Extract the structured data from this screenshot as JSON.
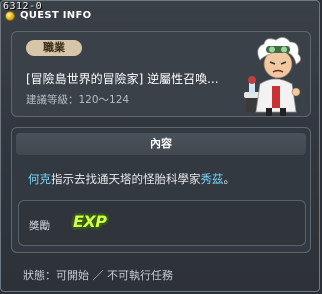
{
  "quest_id": "6312-0",
  "window": {
    "title": "QUEST INFO"
  },
  "quest": {
    "job_label": "職業",
    "name": "[冒險島世界的冒險家] 逆屬性召喚...",
    "level_requirement": "建議等級：120～124"
  },
  "content": {
    "header": "內容",
    "description": {
      "npc_from": "何克",
      "middle_text": "指示去找通天塔的怪胎科學家",
      "npc_to": "秀茲",
      "end_text": "。"
    },
    "reward": {
      "label": "獎勵",
      "exp_text": "EXP"
    }
  },
  "status": "狀態：可開始 ／ 不可執行任務",
  "colors": {
    "highlight_npc": "#78d4ff",
    "exp": "#d6ff4a",
    "badge_bg": "#d6c6a8"
  }
}
